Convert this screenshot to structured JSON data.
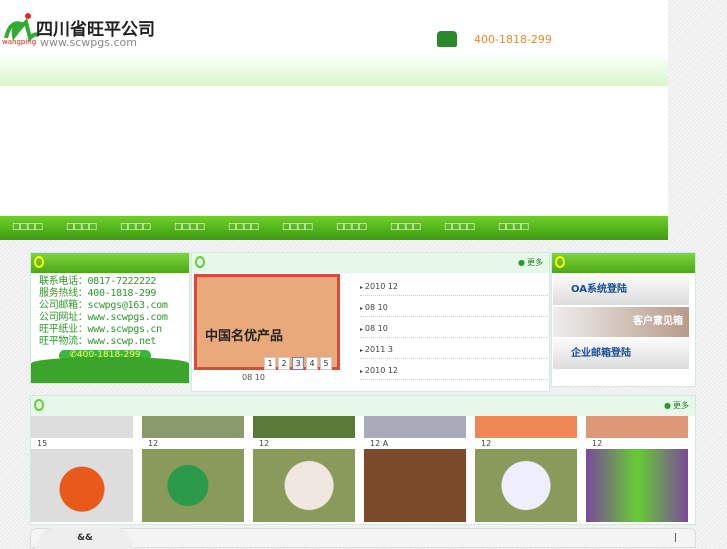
{
  "header": {
    "company": "四川省旺平公司",
    "url": "www.scwpgs.com",
    "logo_sub": "wangping",
    "phone": "400-1818-299"
  },
  "nav": [
    "□□□□",
    "□□□□",
    "□□□□",
    "□□□□",
    "□□□□",
    "□□□□",
    "□□□□",
    "□□□□",
    "□□□□",
    "□□□□"
  ],
  "contact": {
    "lines": [
      "联系电话：0817-7222222",
      "服务热线：400-1818-299",
      "公司邮箱：scwpgs@163.com",
      "公司网址：www.scwpgs.com",
      "旺平纸业：www.scwpgs.cn",
      "旺平物流：www.scwp.net"
    ],
    "hotline": "✆400-1818-299"
  },
  "news": {
    "more": "更多",
    "cert_text": "中国名优产品",
    "caption": "08 10",
    "pages": [
      "1",
      "2",
      "3",
      "4",
      "5"
    ],
    "active_page": "3",
    "items": [
      "2010 12",
      "08 10",
      "08 10",
      "2011 3",
      "2010 12"
    ]
  },
  "services": [
    "OA系统登陆",
    "客户意见箱",
    "企业邮箱登陆"
  ],
  "products": {
    "more": "更多",
    "labels": [
      "15",
      "12",
      "12",
      "12 A",
      "12",
      "12"
    ]
  },
  "footer": {
    "tab": "&&",
    "sep": "|"
  },
  "colors": {
    "green": "#4aa818",
    "orange": "#e88a2a"
  }
}
